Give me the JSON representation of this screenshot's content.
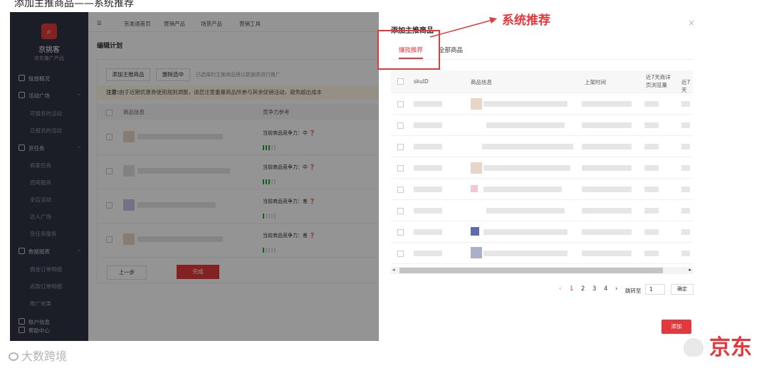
{
  "top_caption": "添加主推商品——系统推荐",
  "sidebar": {
    "brand": "京挑客",
    "brand_sub": "京东推广产品",
    "items": [
      {
        "label": "投放概况"
      },
      {
        "label": "活动广场"
      },
      {
        "label": "可报名的活动"
      },
      {
        "label": "已报名的活动"
      },
      {
        "label": "京任务"
      },
      {
        "label": "商家任务"
      },
      {
        "label": "招商服务"
      },
      {
        "label": "全店活动"
      },
      {
        "label": "达人广场"
      },
      {
        "label": "货任务服务"
      },
      {
        "label": "数据报表"
      },
      {
        "label": "佣金订单明细"
      },
      {
        "label": "返款订单明细"
      },
      {
        "label": "推广效果"
      },
      {
        "label": "账户信息"
      },
      {
        "label": "帮助中心"
      }
    ]
  },
  "topnav": {
    "items": [
      "京准通首页",
      "营销产品",
      "场景产品",
      "营销工具"
    ]
  },
  "page": {
    "title": "编辑计划",
    "add_main_btn": "添加主推商品",
    "delete_btn": "删除选中",
    "hint": "已选择的主推商品将以数据类进行推广",
    "notice_label": "注意:",
    "notice": "由于近期优惠券使用规则调整，请您注意重量商品所参与其余促销活动，避免超出成本",
    "col_product": "商品信息",
    "col_competitiveness": "竞争力参考",
    "rows": [
      {
        "comp_label": "当前商品竞争力：",
        "comp_value": "中"
      },
      {
        "comp_label": "当前商品竞争力：",
        "comp_value": "中"
      },
      {
        "comp_label": "当前商品竞争力：",
        "comp_value": "差"
      },
      {
        "comp_label": "当前商品竞争力：",
        "comp_value": "差"
      }
    ],
    "prev_btn": "上一步",
    "done_btn": "完成"
  },
  "panel": {
    "title": "添加主推商品",
    "close": "×",
    "tabs": [
      "爆款推荐",
      "全部商品"
    ],
    "columns": [
      "skuID",
      "商品信息",
      "上架时间",
      "近7天商详页浏览量",
      "近7天"
    ],
    "pagination": {
      "prev": "‹",
      "pages": [
        "1",
        "2",
        "3",
        "4"
      ],
      "active_page": "1",
      "next": "›",
      "jump_label": "跳转至",
      "jump_value": "1",
      "confirm": "确定"
    },
    "add_btn": "添加"
  },
  "annotation": {
    "label": "系统推荐"
  },
  "watermarks": {
    "left": "大数跨境",
    "right": "京东"
  },
  "colors": {
    "brand_red": "#e4393c",
    "sidebar_bg": "#2f3542",
    "meter_green": "#2aa334"
  }
}
